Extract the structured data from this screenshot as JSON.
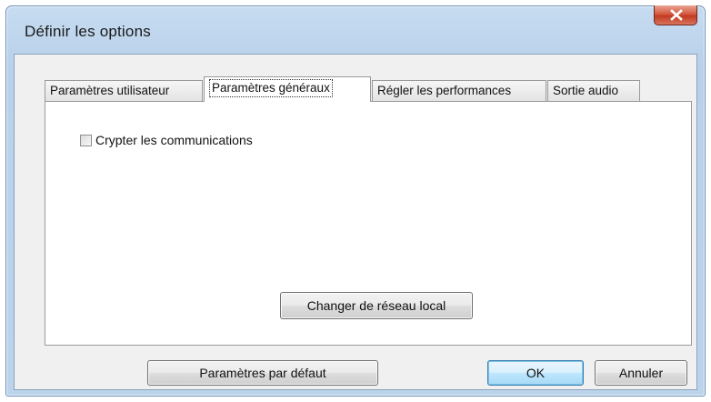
{
  "window": {
    "title": "Définir les options",
    "close_icon": "close-icon"
  },
  "tabs": [
    {
      "label": "Paramètres utilisateur",
      "active": false
    },
    {
      "label": "Paramètres généraux",
      "active": true
    },
    {
      "label": "Régler les performances",
      "active": false
    },
    {
      "label": "Sortie audio",
      "active": false
    }
  ],
  "general": {
    "encrypt_label": "Crypter les communications",
    "encrypt_checked": false,
    "change_lan_label": "Changer de réseau local"
  },
  "footer": {
    "defaults_label": "Paramètres par défaut",
    "ok_label": "OK",
    "cancel_label": "Annuler"
  },
  "colors": {
    "frame": "#bcd3ec",
    "close_button": "#c94a30",
    "ok_highlight": "#bee6fd",
    "client_bg": "#f0f0f0"
  }
}
